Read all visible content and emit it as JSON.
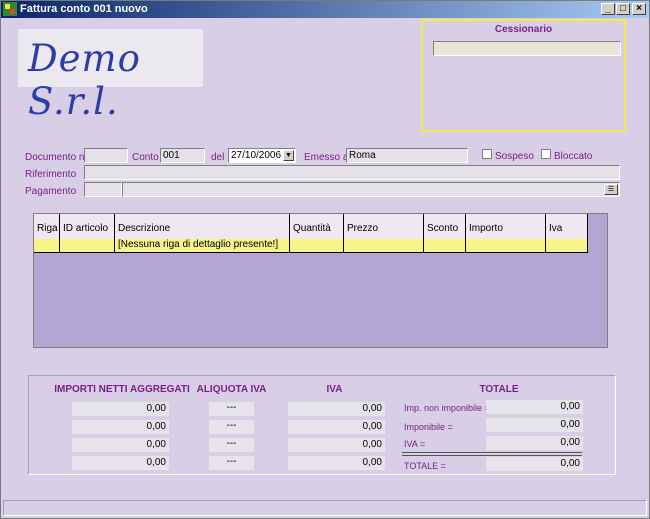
{
  "window": {
    "title": "Fattura conto 001 nuovo",
    "min": "_",
    "max": "□",
    "close": "×"
  },
  "logo": {
    "text": "Demo S.r.l."
  },
  "cessionario": {
    "label": "Cessionario",
    "value": ""
  },
  "form": {
    "documento_label": "Documento n°",
    "documento_value": "",
    "conto_label": "Conto",
    "conto_value": "001",
    "del_label": "del",
    "del_value": "27/10/2006",
    "emesso_label": "Emesso a",
    "emesso_value": "Roma",
    "sospeso_label": "Sospeso",
    "bloccato_label": "Bloccato",
    "riferimento_label": "Riferimento",
    "riferimento_value": "",
    "pagamento_label": "Pagamento",
    "pagamento_code": "",
    "pagamento_desc": ""
  },
  "grid": {
    "columns": [
      "Riga",
      "ID articolo",
      "Descrizione",
      "Quantità",
      "Prezzo",
      "Sconto",
      "Importo",
      "Iva"
    ],
    "row": [
      "",
      "",
      "[Nessuna riga di dettaglio presente!]",
      "",
      "",
      "",
      "",
      ""
    ]
  },
  "totals": {
    "headers": {
      "importi": "IMPORTI NETTI AGGREGATI",
      "aliquota": "ALIQUOTA IVA",
      "iva": "IVA",
      "totale": "TOTALE"
    },
    "importi": [
      "0,00",
      "0,00",
      "0,00",
      "0,00"
    ],
    "aliquote": [
      "---",
      "---",
      "---",
      "---"
    ],
    "iva": [
      "0,00",
      "0,00",
      "0,00",
      "0,00"
    ],
    "summary_labels": [
      "Imp. non imponibile =",
      "Imponibile =",
      "IVA =",
      "TOTALE ="
    ],
    "summary_values": [
      "0,00",
      "0,00",
      "0,00",
      "0,00"
    ]
  },
  "colors": {
    "background": "#d8cfe7",
    "label": "#7a1e8a",
    "row_highlight": "#f6f38a",
    "cessionario_border": "#f2ea4d",
    "logo_text": "#2c3da8"
  }
}
